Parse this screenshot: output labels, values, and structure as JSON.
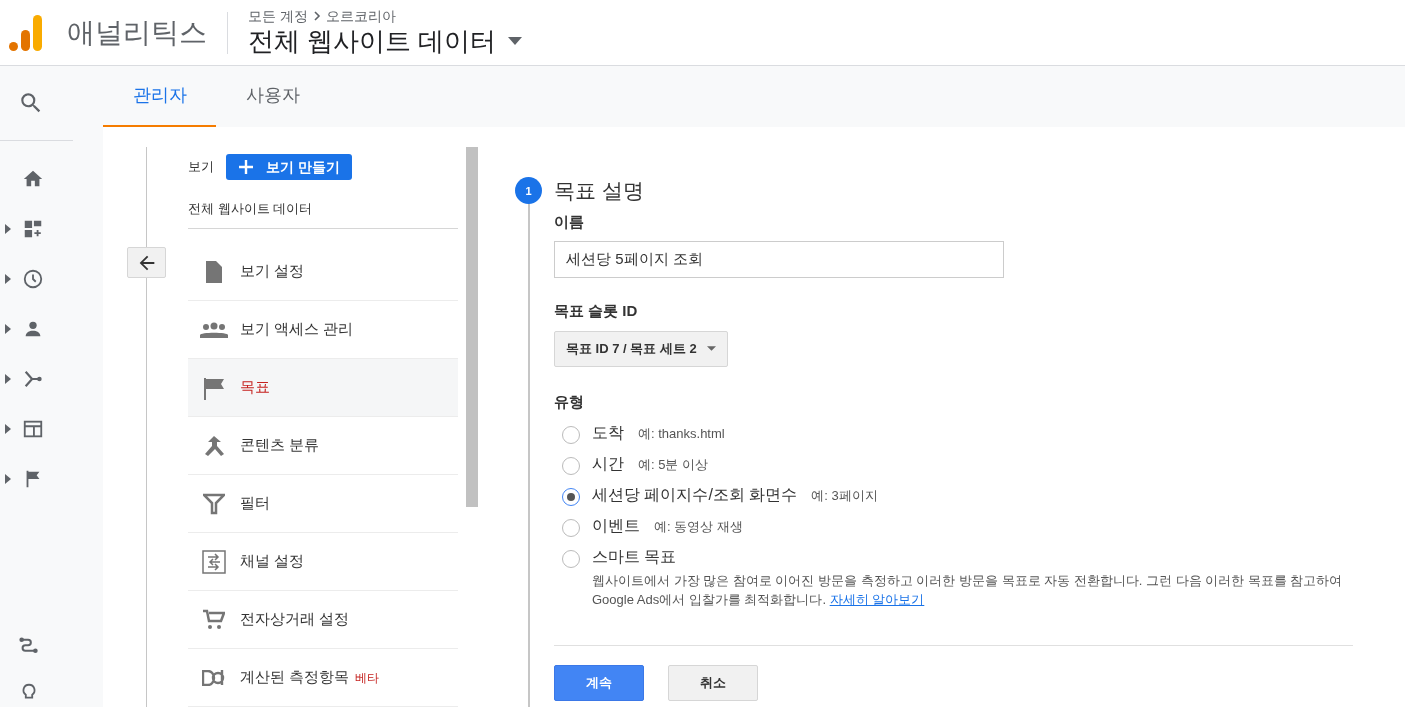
{
  "header": {
    "product": "애널리틱스",
    "breadcrumb": [
      "모든 계정",
      "오르코리아"
    ],
    "view_name": "전체 웹사이트 데이터"
  },
  "tabs": [
    {
      "label": "관리자",
      "selected": true
    },
    {
      "label": "사용자",
      "selected": false
    }
  ],
  "view_column": {
    "label": "보기",
    "create_button": "보기 만들기",
    "view_name": "전체 웹사이트 데이터",
    "items": [
      {
        "label": "보기 설정",
        "selected": false
      },
      {
        "label": "보기 액세스 관리",
        "selected": false
      },
      {
        "label": "목표",
        "selected": true
      },
      {
        "label": "콘텐츠 분류",
        "selected": false
      },
      {
        "label": "필터",
        "selected": false
      },
      {
        "label": "채널 설정",
        "selected": false
      },
      {
        "label": "전자상거래 설정",
        "selected": false
      },
      {
        "label": "계산된 측정항목",
        "badge": "베타",
        "selected": false
      }
    ]
  },
  "goal_form": {
    "step": "1",
    "title": "목표 설명",
    "name_label": "이름",
    "name_value": "세션당 5페이지 조회",
    "slot_label": "목표 슬롯 ID",
    "slot_value": "목표 ID 7 / 목표 세트 2",
    "type_label": "유형",
    "types": [
      {
        "label": "도착",
        "example": "예: thanks.html",
        "selected": false
      },
      {
        "label": "시간",
        "example": "예: 5분 이상",
        "selected": false
      },
      {
        "label": "세션당 페이지수/조회 화면수",
        "example": "예: 3페이지",
        "selected": true
      },
      {
        "label": "이벤트",
        "example": "예: 동영상 재생",
        "selected": false
      },
      {
        "label": "스마트 목표",
        "description": "웹사이트에서 가장 많은 참여로 이어진 방문을 측정하고 이러한 방문을 목표로 자동 전환합니다. 그런 다음 이러한 목표를 참고하여 Google Ads에서 입찰가를 최적화합니다.",
        "link": "자세히 알아보기",
        "selected": false
      }
    ],
    "buttons": [
      {
        "label": "계속",
        "kind": "primary"
      },
      {
        "label": "취소",
        "kind": "secondary"
      }
    ]
  }
}
